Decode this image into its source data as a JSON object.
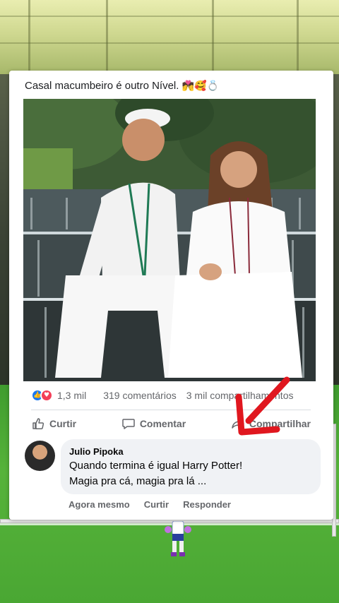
{
  "post": {
    "caption": "Casal macumbeiro é outro Nível.",
    "caption_emoji": "💏🥰💍"
  },
  "reactions": {
    "count": "1,3 mil",
    "comments": "319 comentários",
    "shares": "3 mil compartilhamentos"
  },
  "actions": {
    "like": "Curtir",
    "comment": "Comentar",
    "share": "Compartilhar"
  },
  "comment": {
    "author": "Julio Pipoka",
    "line1": "Quando termina é igual Harry Potter!",
    "line2": "Magia pra cá, magia pra lá ...",
    "time": "Agora mesmo",
    "like": "Curtir",
    "reply": "Responder"
  },
  "colors": {
    "facebook_blue": "#1877f2",
    "love_red": "#f33e58",
    "arrow_red": "#e0171f"
  }
}
